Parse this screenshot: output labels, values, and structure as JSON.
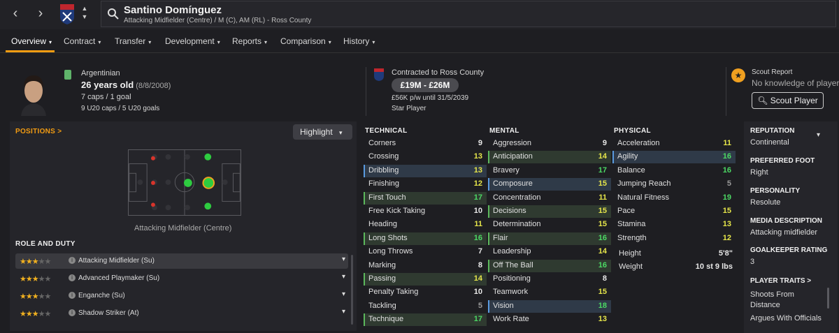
{
  "player": {
    "name": "Santino Domínguez",
    "subtitle": "Attacking Midfielder (Centre) / M (C), AM (RL) - Ross County",
    "nationality": "Argentinian",
    "age_text": "26 years old",
    "dob": "(8/8/2008)",
    "caps": "7 caps / 1 goal",
    "u20": "9 U20 caps / 5 U20 goals"
  },
  "nav": {
    "back": "‹",
    "forward": "›"
  },
  "tabs": [
    {
      "label": "Overview"
    },
    {
      "label": "Contract"
    },
    {
      "label": "Transfer"
    },
    {
      "label": "Development"
    },
    {
      "label": "Reports"
    },
    {
      "label": "Comparison"
    },
    {
      "label": "History"
    }
  ],
  "contract": {
    "title": "Contracted to Ross County",
    "value": "£19M - £26M",
    "wage": "£56K p/w until 31/5/2039",
    "status": "Star Player"
  },
  "scout": {
    "title": "Scout Report",
    "knowledge": "No knowledge of player",
    "button": "Scout Player"
  },
  "positions": {
    "title": "POSITIONS >",
    "highlight": "Highlight",
    "caption": "Attacking Midfielder (Centre)"
  },
  "roles": {
    "title": "ROLE AND DUTY",
    "items": [
      {
        "name": "Attacking Midfielder (Su)",
        "stars": "★★★☆☆"
      },
      {
        "name": "Advanced Playmaker (Su)",
        "stars": "★★★☆☆"
      },
      {
        "name": "Enganche (Su)",
        "stars": "★★★☆☆"
      },
      {
        "name": "Shadow Striker (At)",
        "stars": "★★★☆☆"
      }
    ]
  },
  "technical": {
    "title": "TECHNICAL",
    "items": [
      {
        "n": "Corners",
        "v": "9"
      },
      {
        "n": "Crossing",
        "v": "13"
      },
      {
        "n": "Dribbling",
        "v": "13"
      },
      {
        "n": "Finishing",
        "v": "12"
      },
      {
        "n": "First Touch",
        "v": "17"
      },
      {
        "n": "Free Kick Taking",
        "v": "10"
      },
      {
        "n": "Heading",
        "v": "11"
      },
      {
        "n": "Long Shots",
        "v": "16"
      },
      {
        "n": "Long Throws",
        "v": "7"
      },
      {
        "n": "Marking",
        "v": "8"
      },
      {
        "n": "Passing",
        "v": "14"
      },
      {
        "n": "Penalty Taking",
        "v": "10"
      },
      {
        "n": "Tackling",
        "v": "5"
      },
      {
        "n": "Technique",
        "v": "17"
      }
    ]
  },
  "mental": {
    "title": "MENTAL",
    "items": [
      {
        "n": "Aggression",
        "v": "9"
      },
      {
        "n": "Anticipation",
        "v": "14"
      },
      {
        "n": "Bravery",
        "v": "17"
      },
      {
        "n": "Composure",
        "v": "15"
      },
      {
        "n": "Concentration",
        "v": "11"
      },
      {
        "n": "Decisions",
        "v": "15"
      },
      {
        "n": "Determination",
        "v": "15"
      },
      {
        "n": "Flair",
        "v": "16"
      },
      {
        "n": "Leadership",
        "v": "14"
      },
      {
        "n": "Off The Ball",
        "v": "16"
      },
      {
        "n": "Positioning",
        "v": "8"
      },
      {
        "n": "Teamwork",
        "v": "15"
      },
      {
        "n": "Vision",
        "v": "18"
      },
      {
        "n": "Work Rate",
        "v": "13"
      }
    ]
  },
  "physical": {
    "title": "PHYSICAL",
    "items": [
      {
        "n": "Acceleration",
        "v": "11"
      },
      {
        "n": "Agility",
        "v": "16"
      },
      {
        "n": "Balance",
        "v": "16"
      },
      {
        "n": "Jumping Reach",
        "v": "5"
      },
      {
        "n": "Natural Fitness",
        "v": "19"
      },
      {
        "n": "Pace",
        "v": "15"
      },
      {
        "n": "Stamina",
        "v": "13"
      },
      {
        "n": "Strength",
        "v": "12"
      }
    ],
    "height_label": "Height",
    "height": "5'8\"",
    "weight_label": "Weight",
    "weight": "10 st 9 lbs"
  },
  "side": {
    "reputation_h": "REPUTATION",
    "reputation": "Continental",
    "foot_h": "PREFERRED FOOT",
    "foot": "Right",
    "personality_h": "PERSONALITY",
    "personality": "Resolute",
    "media_h": "MEDIA DESCRIPTION",
    "media": "Attacking midfielder",
    "gk_h": "GOALKEEPER RATING",
    "gk": "3",
    "traits_h": "PLAYER TRAITS >",
    "trait1a": "Shoots From",
    "trait1b": "Distance",
    "trait2": "Argues With Officials"
  }
}
